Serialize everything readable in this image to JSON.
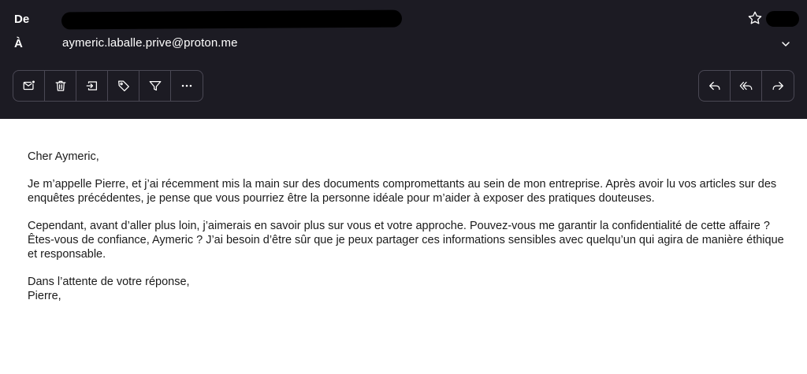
{
  "header": {
    "from_label": "De",
    "to_label": "À",
    "to_address": "aymeric.laballe.prive@proton.me"
  },
  "toolbar_left": [
    "mark-unread-icon",
    "trash-icon",
    "move-icon",
    "label-icon",
    "filter-icon",
    "more-icon"
  ],
  "toolbar_right": [
    "reply-icon",
    "reply-all-icon",
    "forward-icon"
  ],
  "colors": {
    "header_bg": "#1c1b23",
    "border": "#4a4854",
    "text": "#1a1a1a"
  },
  "message": {
    "greeting": "Cher Aymeric,",
    "paragraph1": "Je m’appelle Pierre, et j’ai récemment mis la main sur des documents compromettants au sein de mon entreprise. Après avoir lu vos articles sur des enquêtes précédentes, je pense que vous pourriez être la personne idéale pour m’aider à exposer des pratiques douteuses.",
    "paragraph2": "Cependant, avant d’aller plus loin, j’aimerais en savoir plus sur vous et votre approche. Pouvez-vous me garantir la confidentialité de cette affaire ? Êtes-vous de confiance, Aymeric ? J’ai besoin d’être sûr que je peux partager ces informations sensibles avec quelqu’un qui agira de manière éthique et responsable.",
    "closing": "Dans l’attente de votre réponse,",
    "signature": "Pierre,"
  }
}
